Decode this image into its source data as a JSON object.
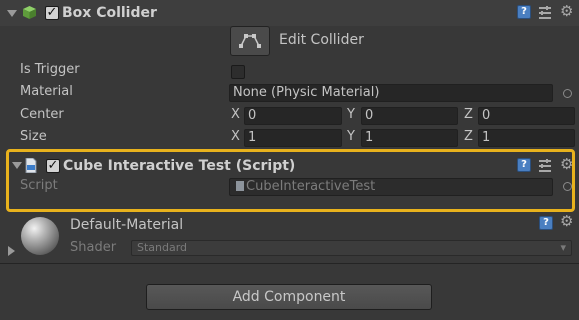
{
  "box_collider": {
    "title": "Box Collider",
    "enabled": true,
    "edit_collider_label": "Edit Collider",
    "is_trigger_label": "Is Trigger",
    "is_trigger": false,
    "material_label": "Material",
    "material_value": "None (Physic Material)",
    "center_label": "Center",
    "center": {
      "x_label": "X",
      "x": "0",
      "y_label": "Y",
      "y": "0",
      "z_label": "Z",
      "z": "0"
    },
    "size_label": "Size",
    "size": {
      "x_label": "X",
      "x": "1",
      "y_label": "Y",
      "y": "1",
      "z_label": "Z",
      "z": "1"
    }
  },
  "script_component": {
    "title": "Cube Interactive Test (Script)",
    "enabled": true,
    "script_label": "Script",
    "script_value": "CubeInteractiveTest",
    "highlight_color": "#e8b21d"
  },
  "material": {
    "name": "Default-Material",
    "shader_label": "Shader",
    "shader_value": "Standard"
  },
  "add_component_label": "Add Component",
  "icons": {
    "help": "help-icon",
    "presets": "presets-icon",
    "settings": "gear-icon",
    "object_picker": "target-icon"
  }
}
